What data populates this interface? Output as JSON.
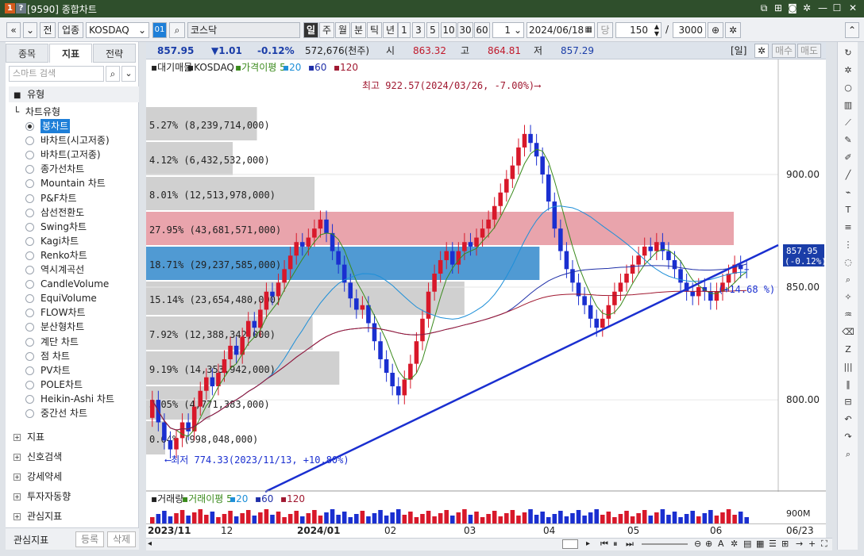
{
  "window": {
    "title": "[9590] 종합차트",
    "badge1": "1",
    "badge2": "?"
  },
  "toolbar": {
    "back_label": "«",
    "dropdown_label": "»",
    "prev_label": "전",
    "sector_label": "업종",
    "market_value": "KOSDAQ",
    "code_value": "01",
    "name_value": "코스닥",
    "periods": [
      "일",
      "주",
      "월",
      "분",
      "틱",
      "년"
    ],
    "minutes": [
      "1",
      "3",
      "5",
      "10",
      "30",
      "60"
    ],
    "count_value": "1",
    "date_value": "2024/06/18",
    "dang_label": "당",
    "bars_value": "150",
    "total_value": "3000"
  },
  "sidebar": {
    "tabs": [
      "종목",
      "지표",
      "전략"
    ],
    "search_placeholder": "스마트 검색",
    "section_label": "유형",
    "tree_root": "차트유형",
    "chart_types": [
      "봉차트",
      "바차트(시고저종)",
      "바차트(고저종)",
      "종가선차트",
      "Mountain 차트",
      "P&F차트",
      "삼선전환도",
      "Swing차트",
      "Kagi차트",
      "Renko차트",
      "역시계곡선",
      "CandleVolume",
      "EquiVolume",
      "FLOW차트",
      "분산형차트",
      "계단 차트",
      "점 차트",
      "PV차트",
      "POLE차트",
      "Heikin-Ashi 차트",
      "중간선 차트"
    ],
    "groups": [
      "지표",
      "신호검색",
      "강세약세",
      "투자자동향",
      "관심지표"
    ],
    "footer_label": "관심지표",
    "register_label": "등록",
    "delete_label": "삭제"
  },
  "infobar": {
    "price": "857.95",
    "change": "▼1.01",
    "change_pct": "-0.12%",
    "volume": "572,676(천주)",
    "open_label": "시",
    "open": "863.32",
    "high_label": "고",
    "high": "864.81",
    "low_label": "저",
    "low": "857.29",
    "period_label": "[일]",
    "buy_label": "매수",
    "sell_label": "매도"
  },
  "legend": {
    "items": [
      "대기매물",
      "KOSDAQ",
      "가격이평 5",
      "20",
      "60",
      "120"
    ],
    "colors": [
      "#222",
      "#222",
      "#3a8a1c",
      "#1e8fd8",
      "#1f2fa8",
      "#a01830"
    ]
  },
  "volume_legend": {
    "items": [
      "거래량",
      "거래이평 5",
      "20",
      "60",
      "120"
    ]
  },
  "chart_data": {
    "type": "candlestick",
    "y_ticks": [
      {
        "label": "900.00",
        "value": 900
      },
      {
        "label": "850.00",
        "value": 850
      },
      {
        "label": "800.00",
        "value": 800
      }
    ],
    "ylim": [
      768,
      944
    ],
    "x_ticks": [
      "2023/11",
      "12",
      "2024/01",
      "02",
      "03",
      "04",
      "05",
      "06"
    ],
    "x_end_label": "06/23",
    "volume_tick": "900M",
    "current_price_label": "857.95",
    "current_change_label": "(-0.12%)",
    "annotations": {
      "high": "최고 922.57(2024/03/26, -7.00%)⟶",
      "low": "⟵최저 774.33(2023/11/13, +10.80%)",
      "trend": "(+14.68 %)"
    },
    "volume_profile": [
      {
        "label": "5.27% (8,239,714,000)",
        "pct": 5.27,
        "color": "#c8c8c8"
      },
      {
        "label": "4.12% (6,432,532,000)",
        "pct": 4.12,
        "color": "#c8c8c8"
      },
      {
        "label": "8.01% (12,513,978,000)",
        "pct": 8.01,
        "color": "#c8c8c8"
      },
      {
        "label": "27.95% (43,681,571,000)",
        "pct": 27.95,
        "color": "#e79aa3"
      },
      {
        "label": "18.71% (29,237,585,000)",
        "pct": 18.71,
        "color": "#3d8fce"
      },
      {
        "label": "15.14% (23,654,480,000)",
        "pct": 15.14,
        "color": "#c8c8c8"
      },
      {
        "label": "7.92% (12,388,342,000)",
        "pct": 7.92,
        "color": "#c8c8c8"
      },
      {
        "label": "9.19% (14,353,942,000)",
        "pct": 9.19,
        "color": "#c8c8c8"
      },
      {
        "label": "3.05% (4,771,383,000)",
        "pct": 3.05,
        "color": "#c8c8c8"
      },
      {
        "label": "0.64% (998,048,000)",
        "pct": 0.64,
        "color": "#c8c8c8"
      }
    ],
    "closes": [
      800,
      790,
      782,
      778,
      783,
      790,
      786,
      797,
      804,
      810,
      806,
      812,
      818,
      824,
      820,
      828,
      835,
      832,
      840,
      848,
      846,
      852,
      858,
      864,
      870,
      868,
      872,
      876,
      880,
      874,
      866,
      860,
      852,
      845,
      840,
      842,
      834,
      826,
      818,
      812,
      806,
      802,
      809,
      816,
      826,
      836,
      848,
      856,
      862,
      866,
      860,
      866,
      870,
      868,
      872,
      876,
      880,
      886,
      892,
      898,
      904,
      912,
      918,
      914,
      908,
      900,
      888,
      876,
      866,
      858,
      852,
      846,
      842,
      836,
      832,
      836,
      842,
      848,
      852,
      856,
      860,
      864,
      868,
      866,
      870,
      866,
      862,
      858,
      852,
      848,
      846,
      850,
      848,
      844,
      848,
      852,
      856,
      860,
      858,
      857.95
    ],
    "opens": [
      792,
      800,
      790,
      782,
      778,
      783,
      790,
      786,
      797,
      804,
      810,
      806,
      812,
      818,
      824,
      820,
      828,
      835,
      832,
      840,
      848,
      846,
      852,
      858,
      864,
      870,
      868,
      872,
      876,
      880,
      874,
      866,
      860,
      852,
      845,
      840,
      842,
      834,
      826,
      818,
      812,
      806,
      802,
      809,
      816,
      826,
      836,
      848,
      856,
      862,
      866,
      860,
      866,
      870,
      868,
      872,
      876,
      880,
      886,
      892,
      898,
      904,
      912,
      918,
      914,
      908,
      900,
      888,
      876,
      866,
      858,
      852,
      846,
      842,
      836,
      832,
      836,
      842,
      848,
      852,
      856,
      860,
      864,
      868,
      866,
      870,
      866,
      862,
      858,
      852,
      848,
      846,
      850,
      848,
      844,
      848,
      852,
      856,
      860,
      858
    ]
  }
}
